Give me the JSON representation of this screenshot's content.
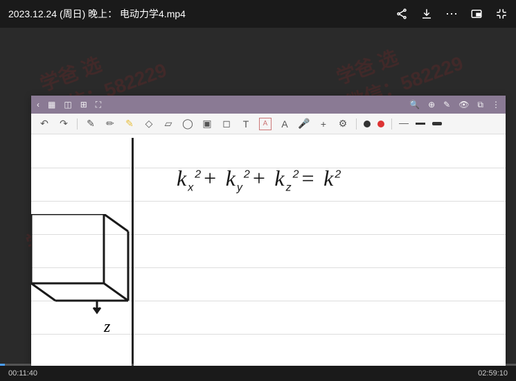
{
  "header": {
    "title": "2023.12.24 (周日) 晚上： 电动力学4.mp4"
  },
  "watermark": {
    "line1": "学爸 选",
    "line2": "微信：582229"
  },
  "playback": {
    "current_time": "00:11:40",
    "total_time": "02:59:10"
  },
  "content": {
    "equation": "k<sub>x</sub><sup>2</sup> + k<sub>y</sub><sup>2</sup> + k<sub>z</sub><sup>2</sup> = k<sup>2</sup>",
    "axis_label": "z"
  }
}
